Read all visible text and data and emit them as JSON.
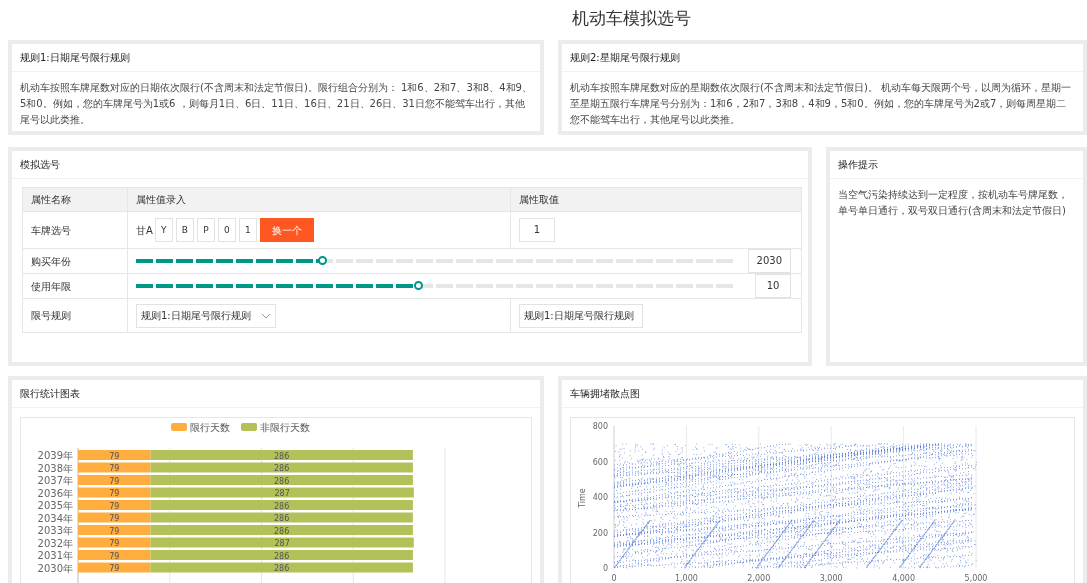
{
  "page_title": "机动车模拟选号",
  "rules": [
    {
      "title": "规则1:日期尾号限行规则",
      "text": "机动车按照车牌尾数对应的日期依次限行(不含周末和法定节假日)。限行组合分别为： 1和6、2和7、3和8、4和9、5和0。例如，您的车牌尾号为1或6 ，则每月1日、6日、11日、16日、21日、26日、31日您不能驾车出行，其他尾号以此类推。"
    },
    {
      "title": "规则2:星期尾号限行规则",
      "text": "机动车按照车牌尾数对应的星期数依次限行(不含周末和法定节假日)。 机动车每天限两个号，以周为循环，星期一至星期五限行车牌尾号分别为：1和6，2和7，3和8，4和9，5和0。例如，您的车牌尾号为2或7，则每周星期二您不能驾车出行，其他尾号以此类推。"
    }
  ],
  "simulator": {
    "title": "模拟选号",
    "columns": [
      "属性名称",
      "属性值录入",
      "属性取值"
    ],
    "plate": {
      "label": "车牌选号",
      "prefix": "甘A",
      "chars": [
        "Y",
        "B",
        "P",
        "0",
        "1"
      ],
      "button": "换一个",
      "value": "1"
    },
    "sliders": [
      {
        "label": "购买年份",
        "level": 0.31,
        "value": "2030"
      },
      {
        "label": "使用年限",
        "level": 0.47,
        "value": "10"
      }
    ],
    "rule_select": {
      "label": "限号规则",
      "selected": "规则1:日期尾号限行规则",
      "value": "规则1:日期尾号限行规则"
    }
  },
  "tips": {
    "title": "操作提示",
    "text": "当空气污染持续达到一定程度，按机动车号牌尾数，单号单日通行，双号双日通行(含周末和法定节假日)"
  },
  "bar_panel": {
    "title": "限行统计图表",
    "chart_data": {
      "type": "bar",
      "orientation": "horizontal",
      "stacked": true,
      "data_labels": true,
      "legend": "top",
      "xlim": [
        0,
        400
      ],
      "categories": [
        "2039年",
        "2038年",
        "2037年",
        "2036年",
        "2035年",
        "2034年",
        "2033年",
        "2032年",
        "2031年",
        "2030年"
      ],
      "series": [
        {
          "name": "限行天数",
          "color": "#ffad3f",
          "values": [
            79,
            79,
            79,
            79,
            79,
            79,
            79,
            79,
            79,
            79
          ]
        },
        {
          "name": "非限行天数",
          "color": "#b3c158",
          "values": [
            286,
            286,
            286,
            287,
            286,
            286,
            286,
            287,
            286,
            286
          ]
        }
      ]
    }
  },
  "scatter_panel": {
    "title": "车辆拥堵散点图",
    "ylabel": "Time",
    "yticks": [
      "800",
      "600",
      "400",
      "200",
      "0"
    ],
    "xticks": [
      "0",
      "1,000",
      "2,000",
      "3,000",
      "4,000",
      "5,000"
    ]
  }
}
